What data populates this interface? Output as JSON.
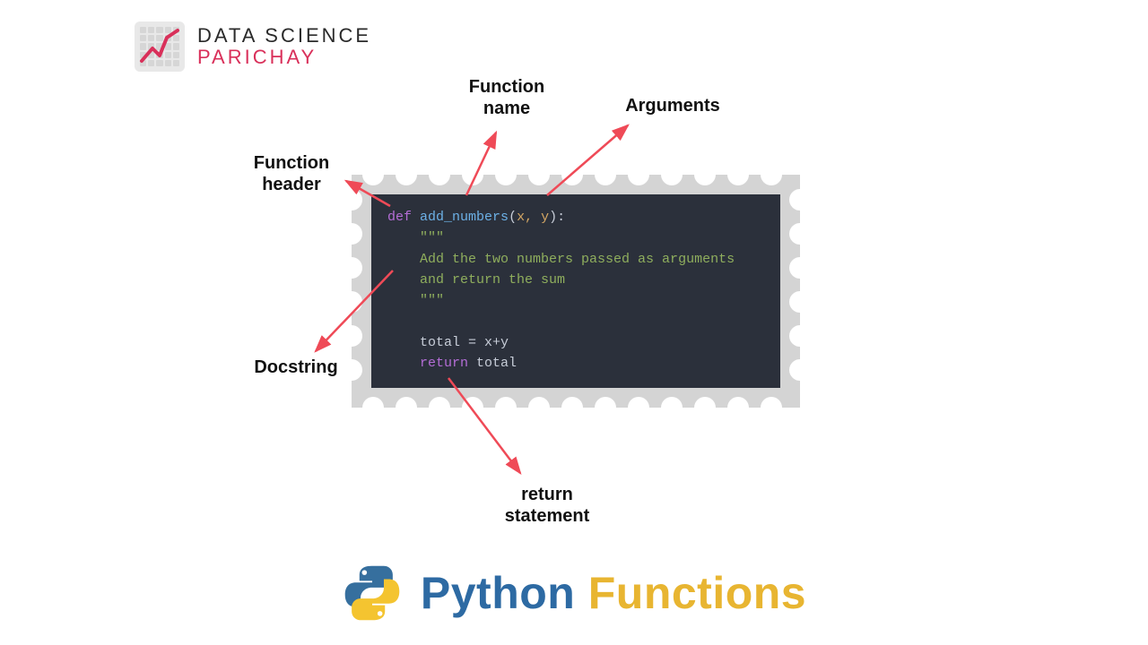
{
  "brand": {
    "line1": "DATA SCIENCE",
    "line2": "PARICHAY"
  },
  "annotations": {
    "function_name": "Function\nname",
    "arguments": "Arguments",
    "function_header": "Function\nheader",
    "docstring": "Docstring",
    "return_statement": "return\nstatement"
  },
  "code": {
    "def": "def",
    "fn": "add_numbers",
    "params": "x, y",
    "doc_open": "\"\"\"",
    "doc_l1": "Add the two numbers passed as arguments",
    "doc_l2": "and return the sum",
    "doc_close": "\"\"\"",
    "assign": "total = x+y",
    "ret_kw": "return",
    "ret_val": " total"
  },
  "title": {
    "word1": "Python",
    "word2": "Functions"
  },
  "colors": {
    "arrow": "#ef4a57",
    "code_bg": "#2b303b",
    "stamp": "#d4d4d4",
    "brand_accent": "#d9305a",
    "title_blue": "#2d6aa3",
    "title_yellow": "#e8b531"
  }
}
